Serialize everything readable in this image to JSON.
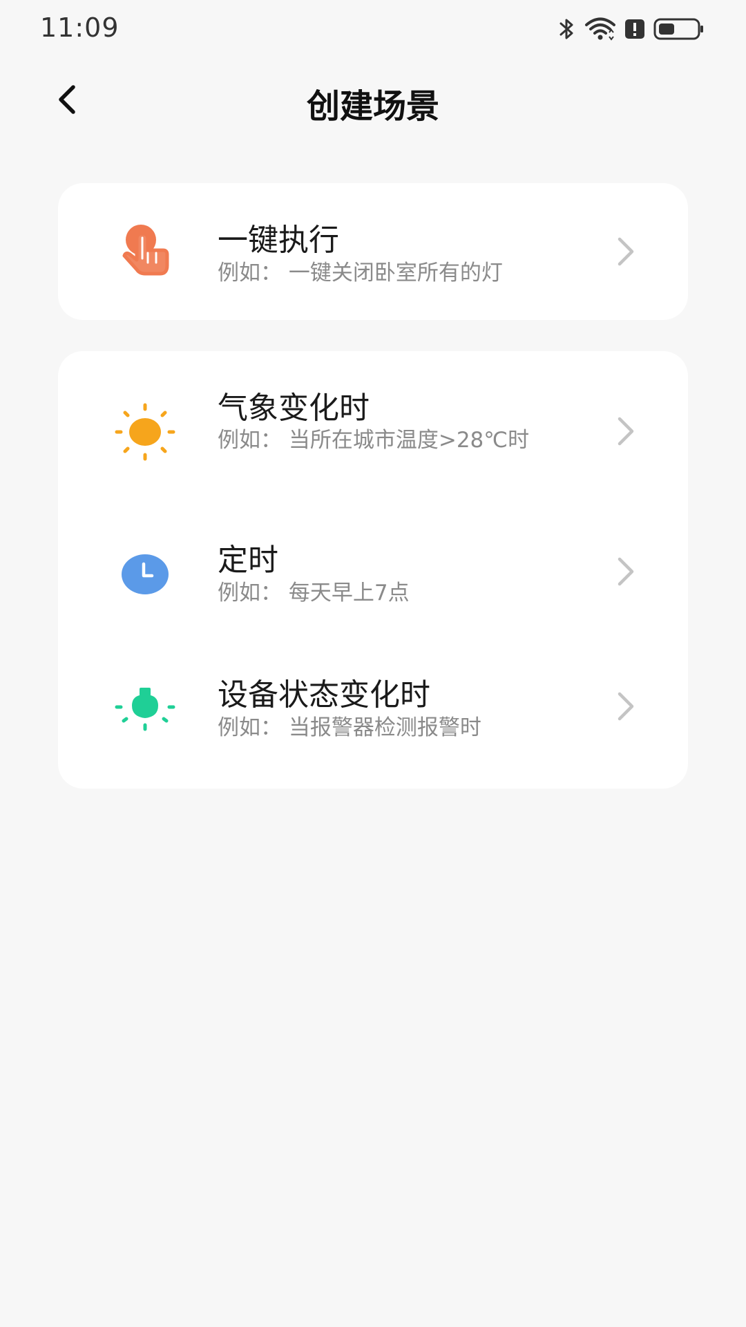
{
  "status_bar": {
    "time": "11:09",
    "icons": [
      "bluetooth-icon",
      "wifi-icon",
      "alert-icon",
      "battery-icon"
    ]
  },
  "header": {
    "title": "创建场景",
    "back_icon": "back-arrow-icon"
  },
  "cards": [
    {
      "items": [
        {
          "icon": "tap-hand-icon",
          "icon_color": "#f07a50",
          "title": "一键执行",
          "description": "例如： 一键关闭卧室所有的灯"
        }
      ]
    },
    {
      "items": [
        {
          "icon": "sun-icon",
          "icon_color": "#f6a51c",
          "title": "气象变化时",
          "description": "例如： 当所在城市温度>28℃时"
        },
        {
          "icon": "clock-icon",
          "icon_color": "#5b9ae8",
          "title": "定时",
          "description": "例如： 每天早上7点"
        },
        {
          "icon": "device-bulb-icon",
          "icon_color": "#1fcf96",
          "title": "设备状态变化时",
          "description": "例如： 当报警器检测报警时"
        }
      ]
    }
  ],
  "colors": {
    "background": "#f7f7f7",
    "card": "#ffffff",
    "title_text": "#1a1a1a",
    "desc_text": "#8a8a8a",
    "chevron": "#c4c4c4"
  }
}
